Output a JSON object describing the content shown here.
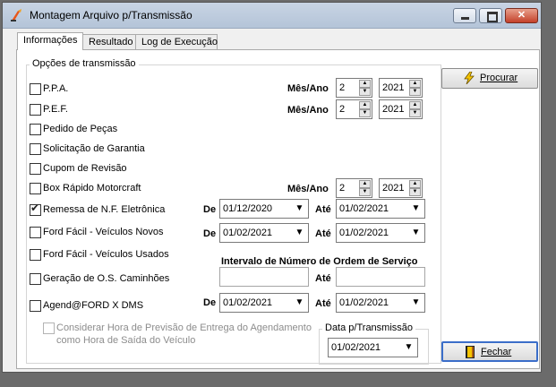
{
  "window": {
    "title": "Montagem Arquivo p/Transmissão",
    "min_glyph": "—",
    "max_glyph": "☐",
    "close_glyph": "✕"
  },
  "tabs": [
    "Informações",
    "Resultado",
    "Log de Execução"
  ],
  "group_title": "Opções de transmissão",
  "options": [
    {
      "label": "P.P.A.",
      "checked": false
    },
    {
      "label": "P.E.F.",
      "checked": false
    },
    {
      "label": "Pedido de Peças",
      "checked": false
    },
    {
      "label": "Solicitação de Garantia",
      "checked": false
    },
    {
      "label": "Cupom de Revisão",
      "checked": false
    },
    {
      "label": "Box Rápido Motorcraft",
      "checked": false
    },
    {
      "label": "Remessa de N.F. Eletrônica",
      "checked": true
    },
    {
      "label": "Ford Fácil - Veículos Novos",
      "checked": false
    },
    {
      "label": "Ford Fácil - Veículos Usados",
      "checked": false
    },
    {
      "label": "Geração de O.S. Caminhões",
      "checked": false
    },
    {
      "label": "Agend@FORD X DMS",
      "checked": false
    }
  ],
  "labels": {
    "mes_ano": "Mês/Ano",
    "de": "De",
    "ate": "Até",
    "interval_title": "Intervalo de Número de Ordem de Serviço"
  },
  "month_year": {
    "ppa": {
      "month": "2",
      "year": "2021"
    },
    "pef": {
      "month": "2",
      "year": "2021"
    },
    "box": {
      "month": "2",
      "year": "2021"
    }
  },
  "ranges": {
    "nfe": {
      "from": "01/12/2020",
      "to": "01/02/2021"
    },
    "ford_novos": {
      "from": "01/02/2021",
      "to": "01/02/2021"
    },
    "agend": {
      "from": "01/02/2021",
      "to": "01/02/2021"
    },
    "os_interval": {
      "from": "",
      "to": ""
    }
  },
  "consider": {
    "label_line1": "Considerar Hora de Previsão de Entrega do Agendamento",
    "label_line2": "como Hora de Saída do Veículo",
    "checked": false,
    "enabled": false
  },
  "transmission_date": {
    "title": "Data p/Transmissão",
    "value": "01/02/2021"
  },
  "buttons": {
    "procurar": "Procurar",
    "fechar": "Fechar",
    "procurar_icon": "lightning-icon",
    "fechar_icon": "door-exit-icon"
  },
  "icons": {
    "spin_up": "▲",
    "spin_down": "▼",
    "dropdown": "▼",
    "check": "✔"
  },
  "colors": {
    "titlebar": "#b4c4d8",
    "close_button": "#c4412a",
    "focus_border": "#3b6ec9"
  }
}
